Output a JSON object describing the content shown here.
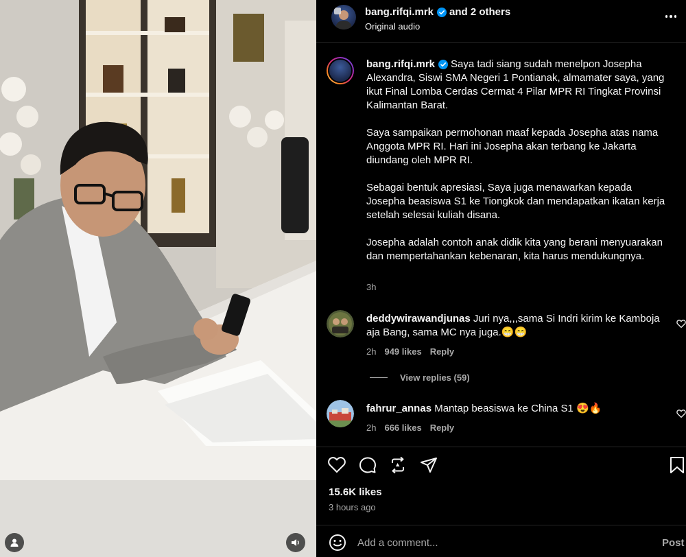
{
  "media": {
    "user_icon": "user-icon",
    "audio_icon": "speaker-icon"
  },
  "header": {
    "author": "bang.rifqi.mrk",
    "and_others": "and 2 others",
    "audio": "Original audio",
    "more_icon": "more-icon"
  },
  "caption": {
    "author": "bang.rifqi.mrk",
    "paragraphs": [
      "Saya tadi siang sudah menelpon Josepha Alexandra, Siswi SMA Negeri 1 Pontianak, almamater saya, yang ikut Final Lomba Cerdas Cermat 4 Pilar MPR RI Tingkat Provinsi Kalimantan Barat.",
      "Saya sampaikan permohonan maaf kepada Josepha atas nama Anggota MPR RI. Hari ini Josepha akan terbang ke Jakarta diundang oleh MPR RI.",
      "Sebagai bentuk apresiasi, Saya juga menawarkan kepada Josepha beasiswa S1 ke Tiongkok dan mendapatkan ikatan kerja setelah selesai kuliah disana.",
      "Josepha adalah contoh anak didik kita yang berani menyuarakan dan mempertahankan kebenaran, kita harus mendukungnya."
    ],
    "time": "3h"
  },
  "comments": [
    {
      "user": "deddywirawandjunas",
      "text": "Juri nya,,,sama Si Indri kirim ke Kamboja aja Bang, sama MC nya juga.😁😁",
      "time": "2h",
      "likes": "949 likes",
      "reply": "Reply"
    },
    {
      "user": "fahrur_annas",
      "text": "Mantap beasiswa ke China S1 😍🔥",
      "time": "2h",
      "likes": "666 likes",
      "reply": "Reply"
    }
  ],
  "view_replies": "View replies (59)",
  "likes": "15.6K likes",
  "posted": "3 hours ago",
  "comment_box": {
    "placeholder": "Add a comment...",
    "post": "Post"
  },
  "colors": {
    "background": "#000000",
    "text": "#f5f5f5",
    "muted": "#a8a8a8",
    "verified": "#0095f6"
  }
}
